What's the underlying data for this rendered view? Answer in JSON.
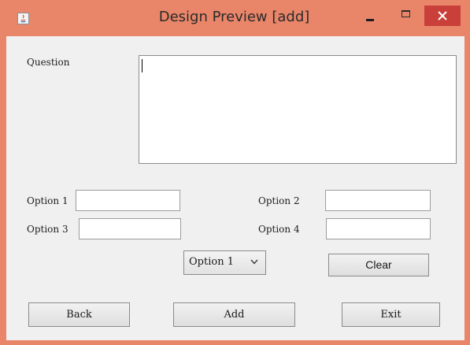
{
  "window": {
    "title": "Design Preview [add]",
    "accent_color": "#e9866a",
    "close_color": "#c9403a",
    "app_icon": "java-icon",
    "controls": [
      "minimize-icon",
      "maximize-icon",
      "close-icon"
    ]
  },
  "form": {
    "question_label": "Question",
    "question_value": "",
    "option1_label": "Option 1",
    "option1_value": "",
    "option2_label": "Option 2",
    "option2_value": "",
    "option3_label": "Option 3",
    "option3_value": "",
    "option4_label": "Option 4",
    "option4_value": "",
    "answer_select_value": "Option 1",
    "clear_label": "Clear"
  },
  "footer": {
    "back_label": "Back",
    "add_label": "Add",
    "exit_label": "Exit"
  }
}
